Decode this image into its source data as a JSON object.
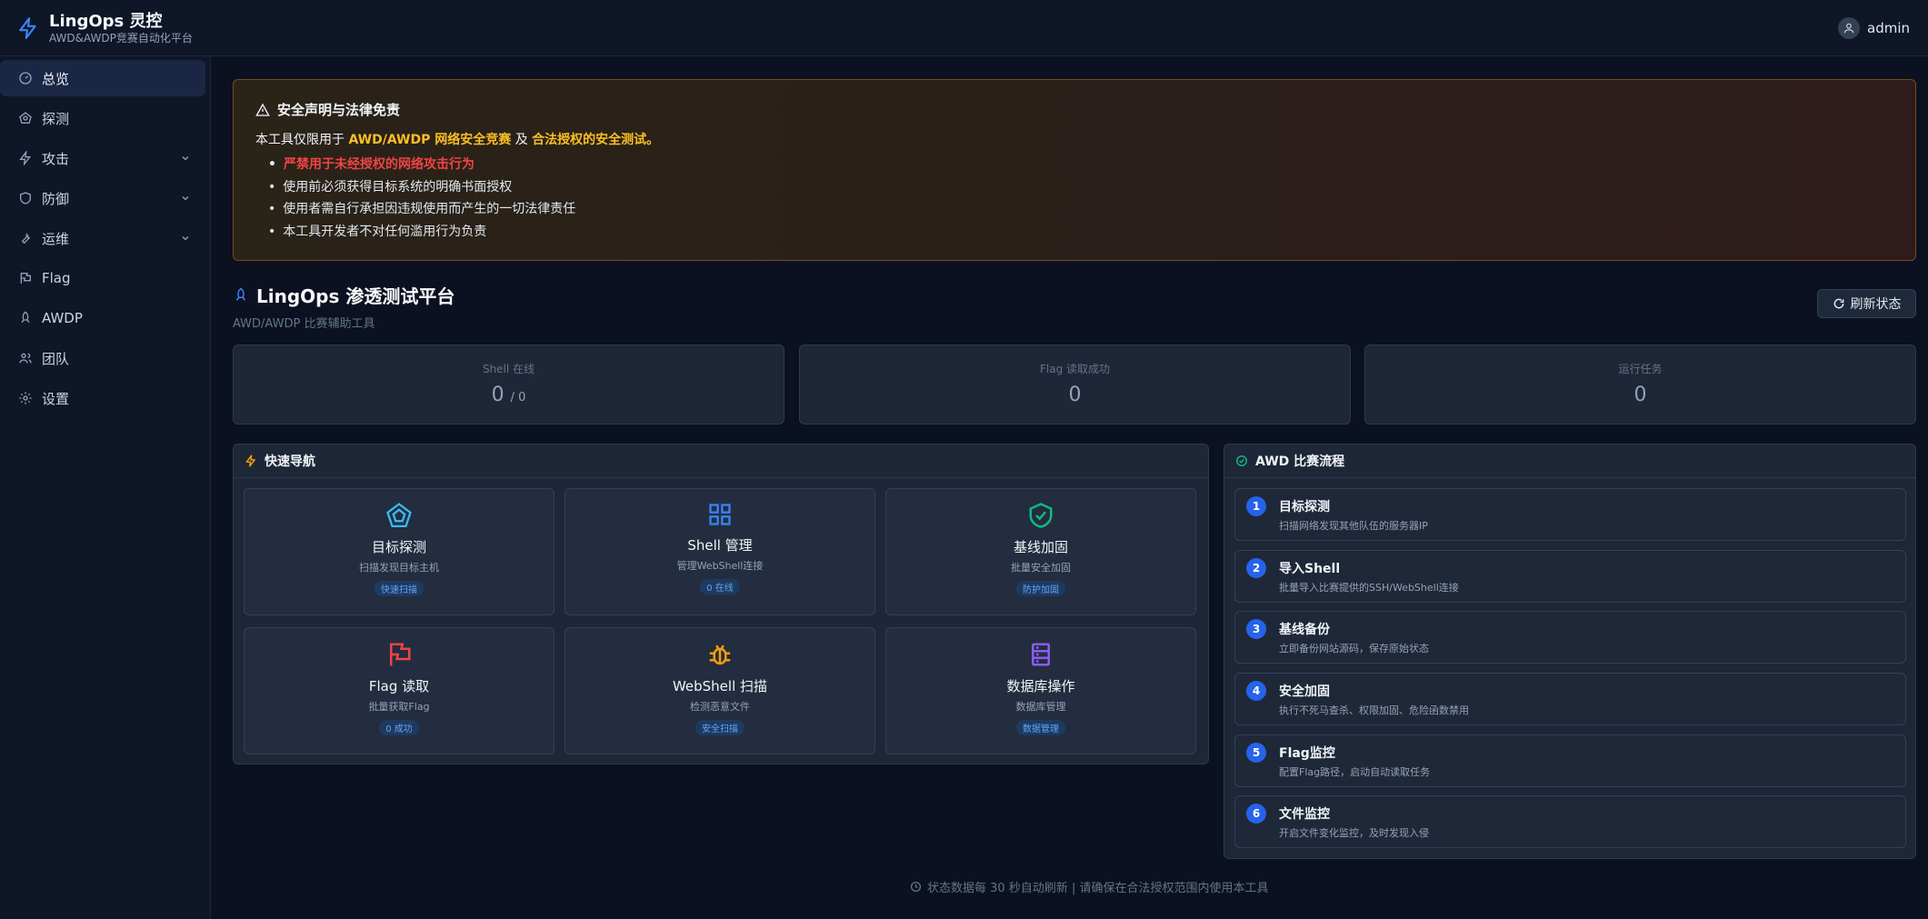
{
  "header": {
    "brand_title": "LingOps 灵控",
    "brand_subtitle": "AWD&AWDP竞赛自动化平台",
    "user_name": "admin"
  },
  "sidebar": {
    "items": [
      {
        "label": "总览",
        "icon": "dashboard-icon"
      },
      {
        "label": "探测",
        "icon": "radar-icon"
      },
      {
        "label": "攻击",
        "icon": "bolt-icon"
      },
      {
        "label": "防御",
        "icon": "shield-icon"
      },
      {
        "label": "运维",
        "icon": "wrench-icon"
      },
      {
        "label": "Flag",
        "icon": "flag-icon"
      },
      {
        "label": "AWDP",
        "icon": "rocket-icon"
      },
      {
        "label": "团队",
        "icon": "users-icon"
      },
      {
        "label": "设置",
        "icon": "gear-icon"
      }
    ]
  },
  "disclaimer": {
    "title": "安全声明与法律免责",
    "intro_prefix": "本工具仅限用于 ",
    "intro_hl1": "AWD/AWDP 网络安全竞赛",
    "intro_mid": " 及 ",
    "intro_hl2": "合法授权的安全测试",
    "intro_suffix": "。",
    "items": [
      "严禁用于未经授权的网络攻击行为",
      "使用前必须获得目标系统的明确书面授权",
      "使用者需自行承担因违规使用而产生的一切法律责任",
      "本工具开发者不对任何滥用行为负责"
    ]
  },
  "page": {
    "title": "LingOps 渗透测试平台",
    "subtitle": "AWD/AWDP 比赛辅助工具",
    "refresh_label": "刷新状态"
  },
  "stats": [
    {
      "label": "Shell 在线",
      "value": "0",
      "suffix": "/ 0"
    },
    {
      "label": "Flag 读取成功",
      "value": "0"
    },
    {
      "label": "运行任务",
      "value": "0"
    }
  ],
  "quick_nav": {
    "title": "快速导航",
    "cards": [
      {
        "name": "目标探测",
        "desc": "扫描发现目标主机",
        "badge": "快速扫描",
        "icon": "radar-icon",
        "color": "#38bdf8"
      },
      {
        "name": "Shell 管理",
        "desc": "管理WebShell连接",
        "badge": "0 在线",
        "icon": "grid-icon",
        "color": "#3b82f6"
      },
      {
        "name": "基线加固",
        "desc": "批量安全加固",
        "badge": "防护加固",
        "icon": "shield-check-icon",
        "color": "#10b981"
      },
      {
        "name": "Flag 读取",
        "desc": "批量获取Flag",
        "badge": "0 成功",
        "icon": "flag-icon",
        "color": "#ef4444"
      },
      {
        "name": "WebShell 扫描",
        "desc": "检测恶意文件",
        "badge": "安全扫描",
        "icon": "bug-icon",
        "color": "#f59e0b"
      },
      {
        "name": "数据库操作",
        "desc": "数据库管理",
        "badge": "数据管理",
        "icon": "database-icon",
        "color": "#8b5cf6"
      }
    ]
  },
  "flow": {
    "title": "AWD 比赛流程",
    "steps": [
      {
        "num": "1",
        "title": "目标探测",
        "desc": "扫描网络发现其他队伍的服务器IP"
      },
      {
        "num": "2",
        "title": "导入Shell",
        "desc": "批量导入比赛提供的SSH/WebShell连接"
      },
      {
        "num": "3",
        "title": "基线备份",
        "desc": "立即备份网站源码，保存原始状态"
      },
      {
        "num": "4",
        "title": "安全加固",
        "desc": "执行不死马查杀、权限加固、危险函数禁用"
      },
      {
        "num": "5",
        "title": "Flag监控",
        "desc": "配置Flag路径，启动自动读取任务"
      },
      {
        "num": "6",
        "title": "文件监控",
        "desc": "开启文件变化监控，及时发现入侵"
      }
    ]
  },
  "footer": {
    "text": "状态数据每 30 秒自动刷新 | 请确保在合法授权范围内使用本工具"
  },
  "colors": {
    "accent": "#2563eb",
    "warning": "#fbbf24",
    "danger": "#ef4444"
  }
}
